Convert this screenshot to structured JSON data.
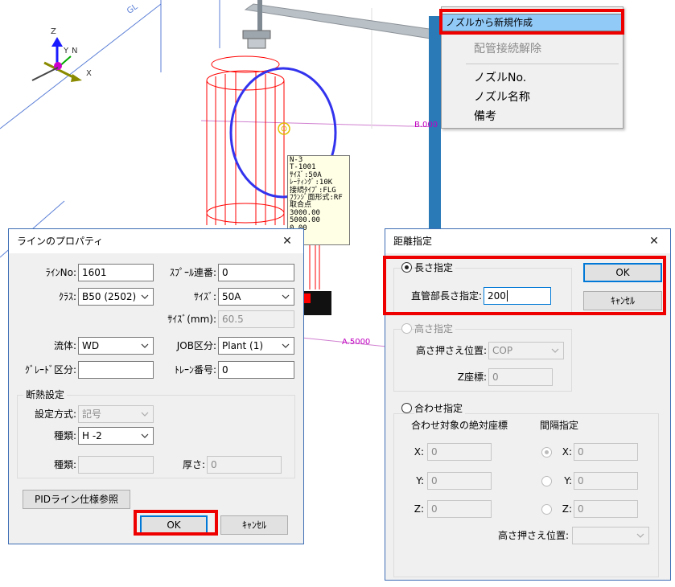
{
  "cad": {
    "axes": {
      "z": "Z",
      "y": "Y",
      "n": "N",
      "x": "X"
    },
    "labels": {
      "top": "GL",
      "b": "B.000",
      "a": "A.5000"
    },
    "tooltip_lines": [
      "N-3",
      "T-1001",
      "ｻｲｽﾞ:50A",
      "ﾚｰﾃｨﾝｸﾞ:10K",
      "接続ﾀｲﾌﾟ:FLG",
      "ﾌﾗﾝｼﾞ面形式:RF",
      "取合点",
      " 3000.00",
      " 5000.00",
      " 0.00"
    ]
  },
  "context_menu": {
    "items": [
      {
        "label": "ノズルから新規作成",
        "state": "highlighted"
      },
      {
        "label": "配管接続解除",
        "state": "disabled"
      },
      {
        "label": "ノズルNo.",
        "state": "normal"
      },
      {
        "label": "ノズル名称",
        "state": "normal"
      },
      {
        "label": "備考",
        "state": "normal"
      }
    ]
  },
  "line_dialog": {
    "title": "ラインのプロパティ",
    "close": "✕",
    "line_no_label": "ﾗｲﾝNo:",
    "line_no_value": "1601",
    "spool_label": "ｽﾌﾟｰﾙ連番:",
    "spool_value": "0",
    "class_label": "ｸﾗｽ:",
    "class_value": "B50 (2502)",
    "size_label": "ｻｲｽﾞ:",
    "size_value": "50A",
    "size_mm_label": "ｻｲｽﾞ(mm):",
    "size_mm_value": "60.5",
    "fluid_label": "流体:",
    "fluid_value": "WD",
    "job_label": "JOB区分:",
    "job_value": "Plant (1)",
    "grade_label": "ｸﾞﾚｰﾄﾞ区分:",
    "grade_value": "",
    "train_label": "ﾄﾚｰﾝ番号:",
    "train_value": "0",
    "insulation_group": "断熱設定",
    "method_label": "設定方式:",
    "method_value": "記号",
    "kind_label": "種類:",
    "kind_value": "H -2",
    "kind2_label": "種類:",
    "kind2_value": "",
    "thickness_label": "厚さ:",
    "thickness_value": "0",
    "pid_button": "PIDライン仕様参照",
    "ok_button": "OK",
    "cancel_button": "ｷｬﾝｾﾙ"
  },
  "distance_dialog": {
    "title": "距離指定",
    "close": "✕",
    "length_radio": "長さ指定",
    "straight_len_label": "直管部長さ指定:",
    "straight_len_value": "200",
    "ok_button": "OK",
    "cancel_button": "ｷｬﾝｾﾙ",
    "height_radio": "高さ指定",
    "height_pos_label": "高さ押さえ位置:",
    "height_pos_value": "COP",
    "z_coord_label": "Z座標:",
    "z_coord_value": "0",
    "match_radio": "合わせ指定",
    "abs_coord_label": "合わせ対象の絶対座標",
    "interval_label": "間隔指定",
    "x_label": "X:",
    "x_value": "0",
    "y_label": "Y:",
    "y_value": "0",
    "z_label": "Z:",
    "z_value": "0",
    "ix_label": "X:",
    "ix_value": "0",
    "iy_label": "Y:",
    "iy_value": "0",
    "iz_label": "Z:",
    "iz_value": "0",
    "height_pos2_label": "高さ押さえ位置:",
    "height_pos2_value": ""
  },
  "colors": {
    "highlight": "#ee0000",
    "menu_selected": "#91c9f7",
    "cad_red": "#ff0000",
    "cad_blue_circle": "#3333ee"
  }
}
